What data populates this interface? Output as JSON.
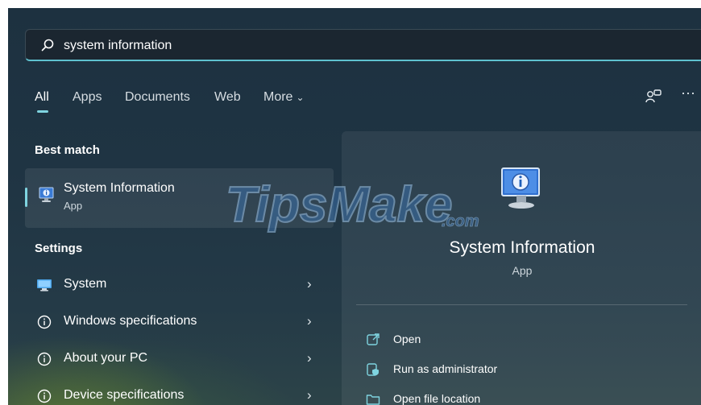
{
  "search": {
    "query": "system information"
  },
  "tabs": [
    {
      "label": "All",
      "active": true
    },
    {
      "label": "Apps"
    },
    {
      "label": "Documents"
    },
    {
      "label": "Web"
    },
    {
      "label": "More"
    }
  ],
  "toolbar_icons": [
    "account-switch-icon",
    "more-options-icon"
  ],
  "toolbar": {
    "more_glyph": "···"
  },
  "best_match": {
    "section_title": "Best match",
    "name": "System Information",
    "type": "App"
  },
  "settings": {
    "section_title": "Settings",
    "items": [
      {
        "label": "System",
        "icon": "monitor-icon"
      },
      {
        "label": "Windows specifications",
        "icon": "info-circle-icon"
      },
      {
        "label": "About your PC",
        "icon": "info-circle-icon"
      },
      {
        "label": "Device specifications",
        "icon": "info-circle-icon"
      }
    ]
  },
  "detail": {
    "title": "System Information",
    "subtitle": "App",
    "actions": [
      {
        "label": "Open",
        "icon": "open-external-icon"
      },
      {
        "label": "Run as administrator",
        "icon": "shield-admin-icon"
      },
      {
        "label": "Open file location",
        "icon": "folder-icon"
      }
    ]
  },
  "watermark": {
    "text": "TipsMake",
    "suffix": ".com"
  },
  "colors": {
    "accent": "#7fd4e0",
    "search_border": "#5fc2cf"
  }
}
